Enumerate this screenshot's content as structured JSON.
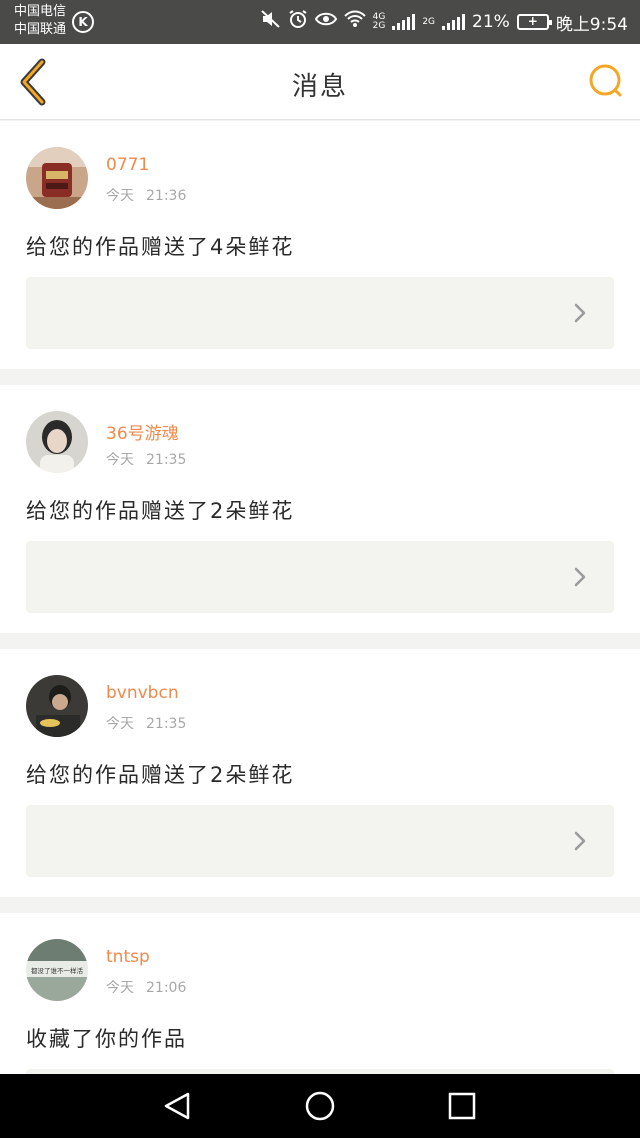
{
  "status_bar": {
    "carrier_1": "中国电信",
    "carrier_2": "中国联通",
    "k_badge": "K",
    "network_1": "4G",
    "network_2": "2G",
    "network_3": "2G",
    "battery_level": "21%",
    "time": "晚上9:54"
  },
  "header": {
    "title": "消息",
    "back_icon": "chevron-left-icon",
    "search_icon": "search-icon",
    "accent_color": "#f5a623"
  },
  "feed": {
    "username_color": "#f08a4b",
    "items": [
      {
        "username": "0771",
        "day": "今天",
        "time": "21:36",
        "message": "给您的作品赠送了4朵鲜花"
      },
      {
        "username": "36号游魂",
        "day": "今天",
        "time": "21:35",
        "message": "给您的作品赠送了2朵鲜花"
      },
      {
        "username": "bvnvbcn",
        "day": "今天",
        "time": "21:35",
        "message": "给您的作品赠送了2朵鲜花"
      },
      {
        "username": "tntsp",
        "day": "今天",
        "time": "21:06",
        "message": "收藏了你的作品",
        "avatar_caption": "都没了谁不一样活"
      }
    ]
  },
  "nav_bar": {
    "back_icon": "triangle-back-icon",
    "home_icon": "circle-home-icon",
    "recents_icon": "square-recents-icon"
  }
}
